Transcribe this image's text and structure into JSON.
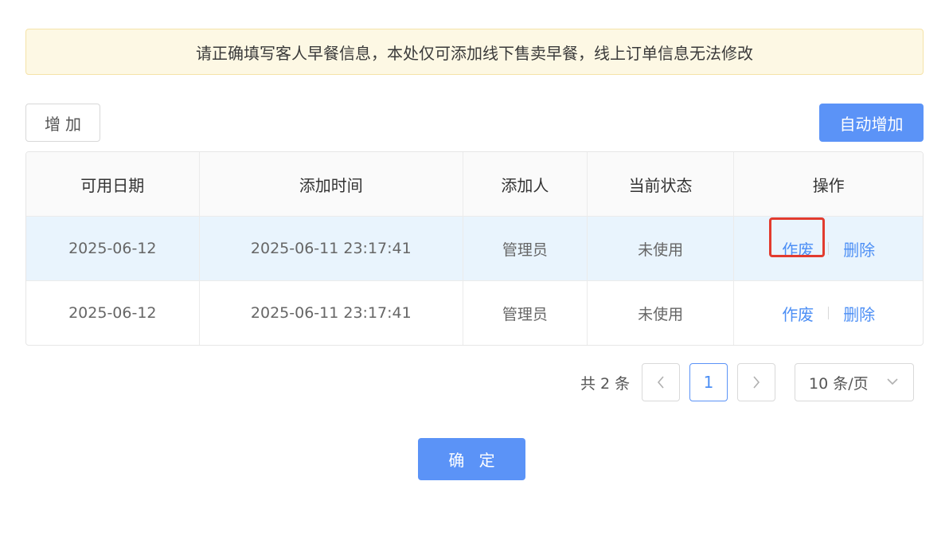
{
  "notice": "请正确填写客人早餐信息，本处仅可添加线下售卖早餐，线上订单信息无法修改",
  "toolbar": {
    "add_label": "增加",
    "auto_add_label": "自动增加"
  },
  "table": {
    "headers": [
      "可用日期",
      "添加时间",
      "添加人",
      "当前状态",
      "操作"
    ],
    "rows": [
      {
        "date": "2025-06-12",
        "added_time": "2025-06-11 23:17:41",
        "added_by": "管理员",
        "status": "未使用",
        "void_label": "作废",
        "delete_label": "删除"
      },
      {
        "date": "2025-06-12",
        "added_time": "2025-06-11 23:17:41",
        "added_by": "管理员",
        "status": "未使用",
        "void_label": "作废",
        "delete_label": "删除"
      }
    ]
  },
  "pagination": {
    "total_text": "共 2 条",
    "current_page": "1",
    "page_size": "10 条/页"
  },
  "confirm_label": "确 定",
  "colors": {
    "primary": "#5b93f7",
    "link": "#4d8ff5",
    "highlight_row": "#e9f4fd",
    "annotation": "#e23b2e"
  }
}
